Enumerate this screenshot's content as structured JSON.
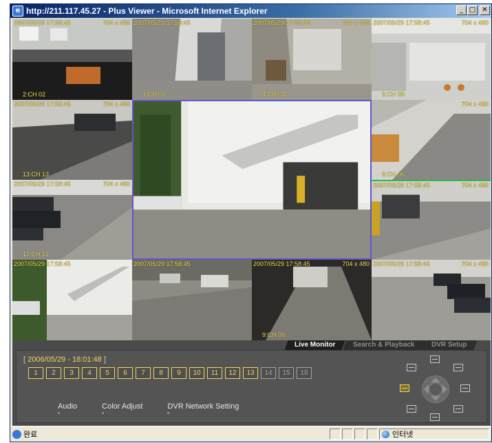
{
  "window": {
    "title": "http://211.117.45.27 - Plus Viewer - Microsoft Internet Explorer",
    "minimize_glyph": "_",
    "restore_glyph": "□",
    "close_glyph": "✕",
    "app_icon": "ie-icon"
  },
  "tiles": [
    {
      "timestamp": "2007/05/29 17:58:45",
      "resolution": "704 x 480",
      "caption": "2:CH 02"
    },
    {
      "timestamp": "2007/05/29 17:58:45",
      "resolution": "",
      "caption": "3:CH 03"
    },
    {
      "timestamp": "2007/05/29 17:58:45",
      "resolution": "704 x 480",
      "caption": "4:CH 04"
    },
    {
      "timestamp": "2007/05/29 17:58:45",
      "resolution": "704 x 480",
      "caption": "5:CH 05"
    },
    {
      "timestamp": "2007/05/29 17:58:45",
      "resolution": "704 x 480",
      "caption": "13:CH 13"
    },
    {
      "timestamp": "",
      "resolution": "",
      "caption": ""
    },
    {
      "timestamp": "",
      "resolution": "704 x 480",
      "caption": "6:CH 06"
    },
    {
      "timestamp": "2007/05/29 17:58:45",
      "resolution": "704 x 480",
      "caption": "12:CH 12"
    },
    {
      "timestamp": "2007/05/29 17:58:45",
      "resolution": "704 x 480",
      "caption": ""
    },
    {
      "timestamp": "2007/05/29 17:58:45",
      "resolution": "",
      "caption": ""
    },
    {
      "timestamp": "2007/05/29 17:58:45",
      "resolution": "",
      "caption": ""
    },
    {
      "timestamp": "2007/05/29 17:58:45",
      "resolution": "704 x 480",
      "caption": "9:CH 09"
    },
    {
      "timestamp": "2007/05/29 17:58:45",
      "resolution": "704 x 480",
      "caption": ""
    }
  ],
  "tabs": [
    "Live Monitor",
    "Search & Playback",
    "DVR Setup"
  ],
  "clock": "2006/05/29 - 18:01:48",
  "clock_open": "[",
  "clock_close": "]",
  "channel_buttons": [
    "1",
    "2",
    "3",
    "4",
    "5",
    "6",
    "7",
    "8",
    "9",
    "10",
    "11",
    "12",
    "13",
    "14",
    "15",
    "16"
  ],
  "links": [
    "Audio",
    "Color Adjust",
    "DVR Network Setting"
  ],
  "ptz_icons": [
    "layout-single-icon",
    "layout-4-icon",
    "layout-9-icon",
    "layout-16-icon",
    "layout-6-icon",
    "layout-8-icon",
    "layout-10-icon",
    "layout-13-icon"
  ],
  "status": {
    "left_text": "완료",
    "zone_text": "인터넷"
  },
  "colors": {
    "accent_yellow": "#f0d45a",
    "panel_bg": "#4a4a4a",
    "selected_border": "#5d58c9"
  }
}
